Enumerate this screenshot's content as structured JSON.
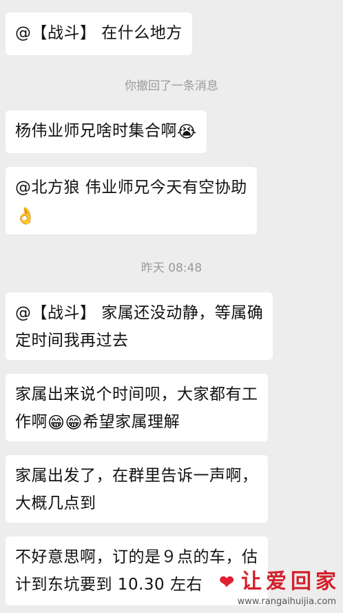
{
  "messages": [
    {
      "text": "@【战斗】 在什么地方"
    },
    {
      "text": "杨伟业师兄啥时集合啊",
      "emoji": "😭"
    },
    {
      "line1": "@北方狼  伟业师兄今天有空协助",
      "emoji": "👌"
    },
    {
      "line1": "@【战斗】 家属还没动静，等属确",
      "line2": "定时间我再过去"
    },
    {
      "line1": "家属出来说个时间呗，大家都有工",
      "line2_pre": "作啊",
      "emoji1": "😁",
      "emoji2": "😁",
      "line2_post": "希望家属理解"
    },
    {
      "line1": "家属出发了，在群里告诉一声啊，",
      "line2": "大概几点到"
    },
    {
      "line1": "不好意思啊，订的是９点的车，估",
      "line2": "计到东坑要到 10.30 左右"
    }
  ],
  "system": {
    "recall_notice": "你撤回了一条消息",
    "timestamp": "昨天 08:48"
  },
  "watermark": {
    "brand": "让爱回家",
    "url": "www.rangaihuijia.com"
  },
  "colors": {
    "background": "#ededed",
    "bubble": "#ffffff",
    "brand": "#d41f2a"
  }
}
